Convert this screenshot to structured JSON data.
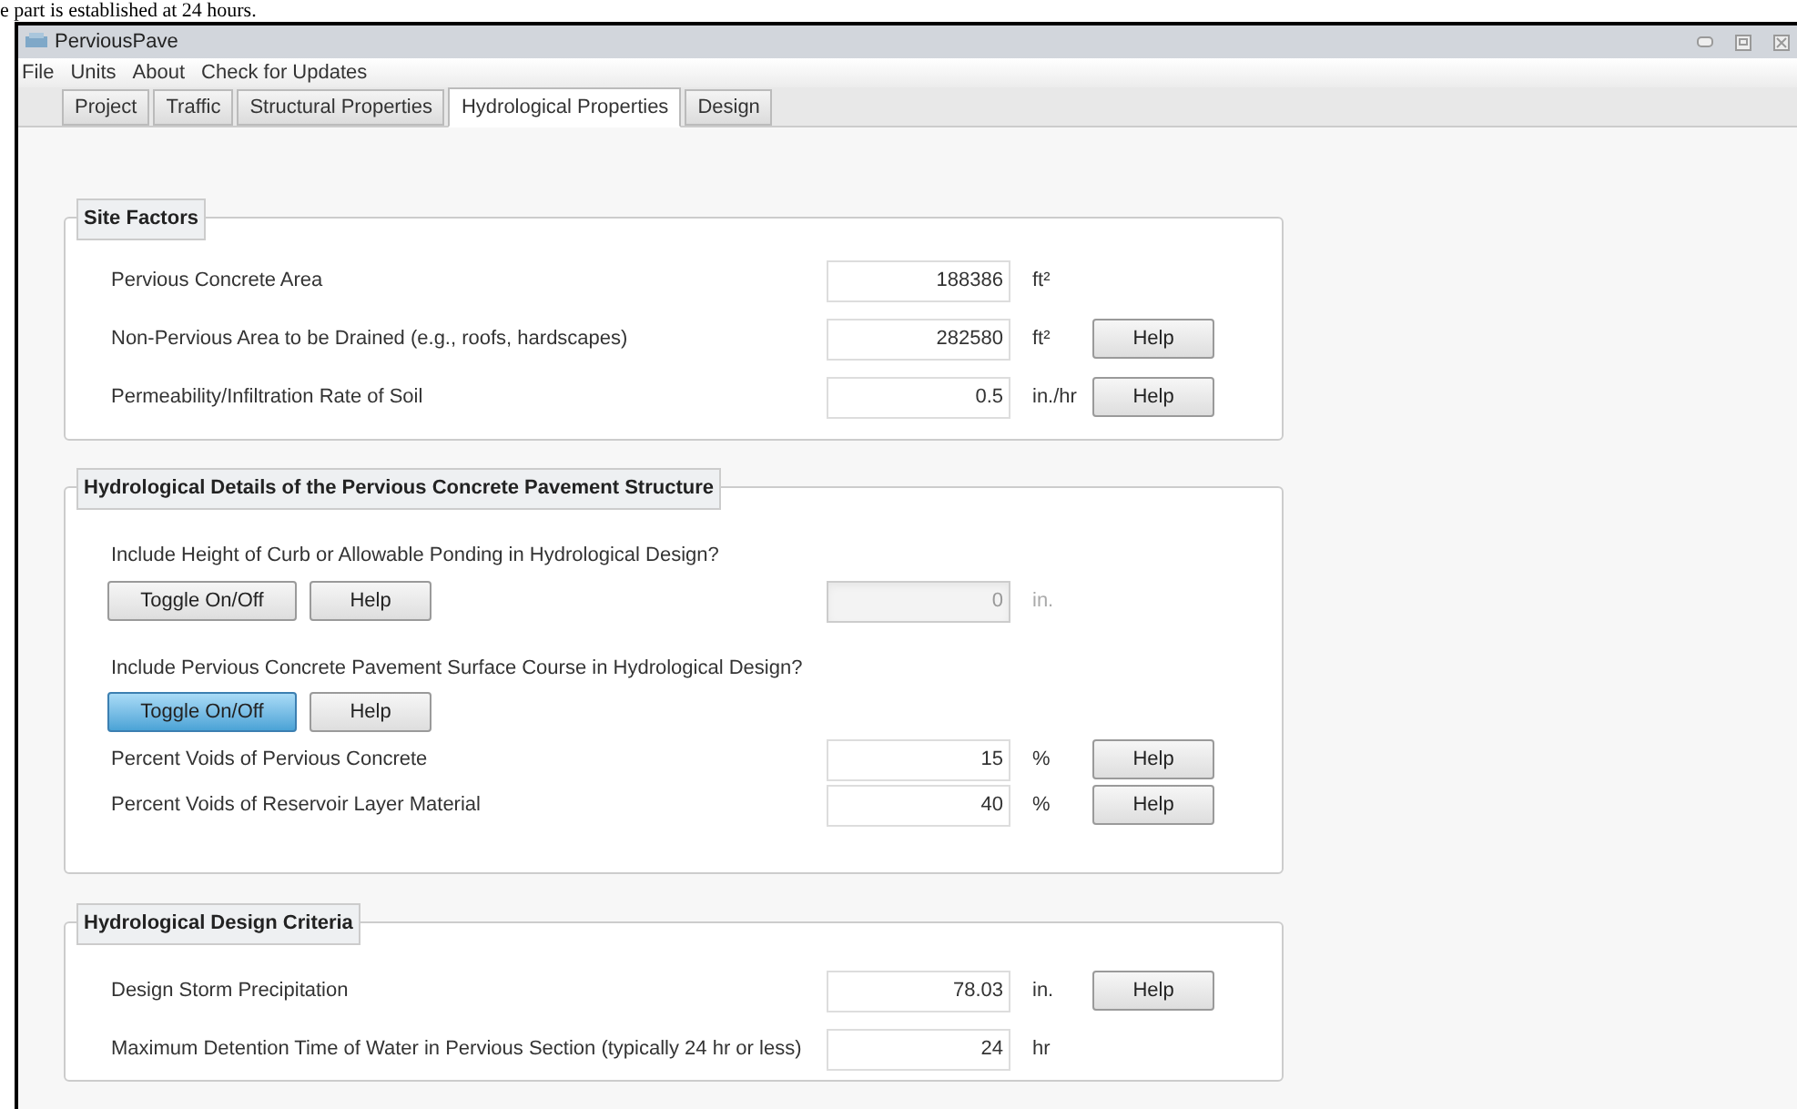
{
  "caption_fragment": "e part is established at 24 hours.",
  "window": {
    "title": "PerviousPave"
  },
  "menu": [
    "File",
    "Units",
    "About",
    "Check for Updates"
  ],
  "tabs": [
    {
      "label": "Project",
      "selected": false
    },
    {
      "label": "Traffic",
      "selected": false
    },
    {
      "label": "Structural Properties",
      "selected": false
    },
    {
      "label": "Hydrological Properties",
      "selected": true
    },
    {
      "label": "Design",
      "selected": false
    }
  ],
  "sections": [
    {
      "title": "Site Factors",
      "rows": [
        {
          "kind": "field",
          "label": "Pervious Concrete Area",
          "value": "188386",
          "unit": "ft²",
          "disabled": false
        },
        {
          "kind": "field",
          "label": "Non-Pervious Area to be Drained (e.g., roofs, hardscapes)",
          "value": "282580",
          "unit": "ft²",
          "help": "Help",
          "disabled": false
        },
        {
          "kind": "field",
          "label": "Permeability/Infiltration Rate of Soil",
          "value": "0.5",
          "unit": "in./hr",
          "help": "Help",
          "disabled": false
        }
      ]
    },
    {
      "title": "Hydrological Details of the Pervious Concrete Pavement Structure",
      "rows": [
        {
          "kind": "question",
          "label": "Include Height of Curb or Allowable Ponding in Hydrological Design?"
        },
        {
          "kind": "toggle",
          "buttons": [
            {
              "label": "Toggle On/Off",
              "active": false
            },
            {
              "label": "Help",
              "active": false
            }
          ],
          "value": "0",
          "unit": "in.",
          "disabled": true
        },
        {
          "kind": "question",
          "label": "Include Pervious Concrete Pavement Surface Course in Hydrological Design?"
        },
        {
          "kind": "toggle",
          "buttons": [
            {
              "label": "Toggle On/Off",
              "active": true
            },
            {
              "label": "Help",
              "active": false
            }
          ]
        },
        {
          "kind": "field",
          "label": "Percent Voids of Pervious Concrete",
          "value": "15",
          "unit": "%",
          "help": "Help",
          "disabled": false
        },
        {
          "kind": "field",
          "label": "Percent Voids of Reservoir Layer Material",
          "value": "40",
          "unit": "%",
          "help": "Help",
          "disabled": false
        }
      ]
    },
    {
      "title": "Hydrological Design Criteria",
      "rows": [
        {
          "kind": "field",
          "label": "Design Storm Precipitation",
          "value": "78.03",
          "unit": "in.",
          "help": "Help",
          "disabled": false
        },
        {
          "kind": "field",
          "label": "Maximum Detention Time of Water in Pervious Section (typically 24 hr or less)",
          "value": "24",
          "unit": "hr",
          "disabled": false
        }
      ]
    }
  ]
}
